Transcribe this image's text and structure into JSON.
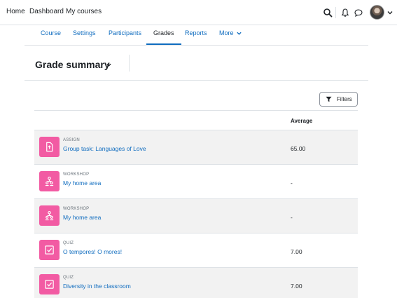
{
  "topnav": {
    "links": [
      "Home",
      "Dashboard",
      "My courses"
    ],
    "icons": [
      "search-icon",
      "bell-icon",
      "chat-icon"
    ]
  },
  "secondary_nav": {
    "tabs": [
      {
        "label": "Course",
        "active": false
      },
      {
        "label": "Settings",
        "active": false
      },
      {
        "label": "Participants",
        "active": false
      },
      {
        "label": "Grades",
        "active": true
      },
      {
        "label": "Reports",
        "active": false
      },
      {
        "label": "More",
        "active": false
      }
    ]
  },
  "page": {
    "title": "Grade summary",
    "filters_label": "Filters"
  },
  "table": {
    "columns": [
      "",
      "Average"
    ],
    "rows": [
      {
        "type": "ASSIGN",
        "name": "Group task: Languages of Love",
        "average": "65.00",
        "icon": "assignment-icon"
      },
      {
        "type": "WORKSHOP",
        "name": "My home area",
        "average": "-",
        "icon": "workshop-icon"
      },
      {
        "type": "WORKSHOP",
        "name": "My home area",
        "average": "-",
        "icon": "workshop-icon"
      },
      {
        "type": "QUIZ",
        "name": "O tempores! O mores!",
        "average": "7.00",
        "icon": "quiz-icon"
      },
      {
        "type": "QUIZ",
        "name": "Diversity in the classroom",
        "average": "7.00",
        "icon": "quiz-icon"
      }
    ]
  },
  "colors": {
    "accent": "#0f6cbf",
    "activity_tile": "#f25ba3"
  }
}
